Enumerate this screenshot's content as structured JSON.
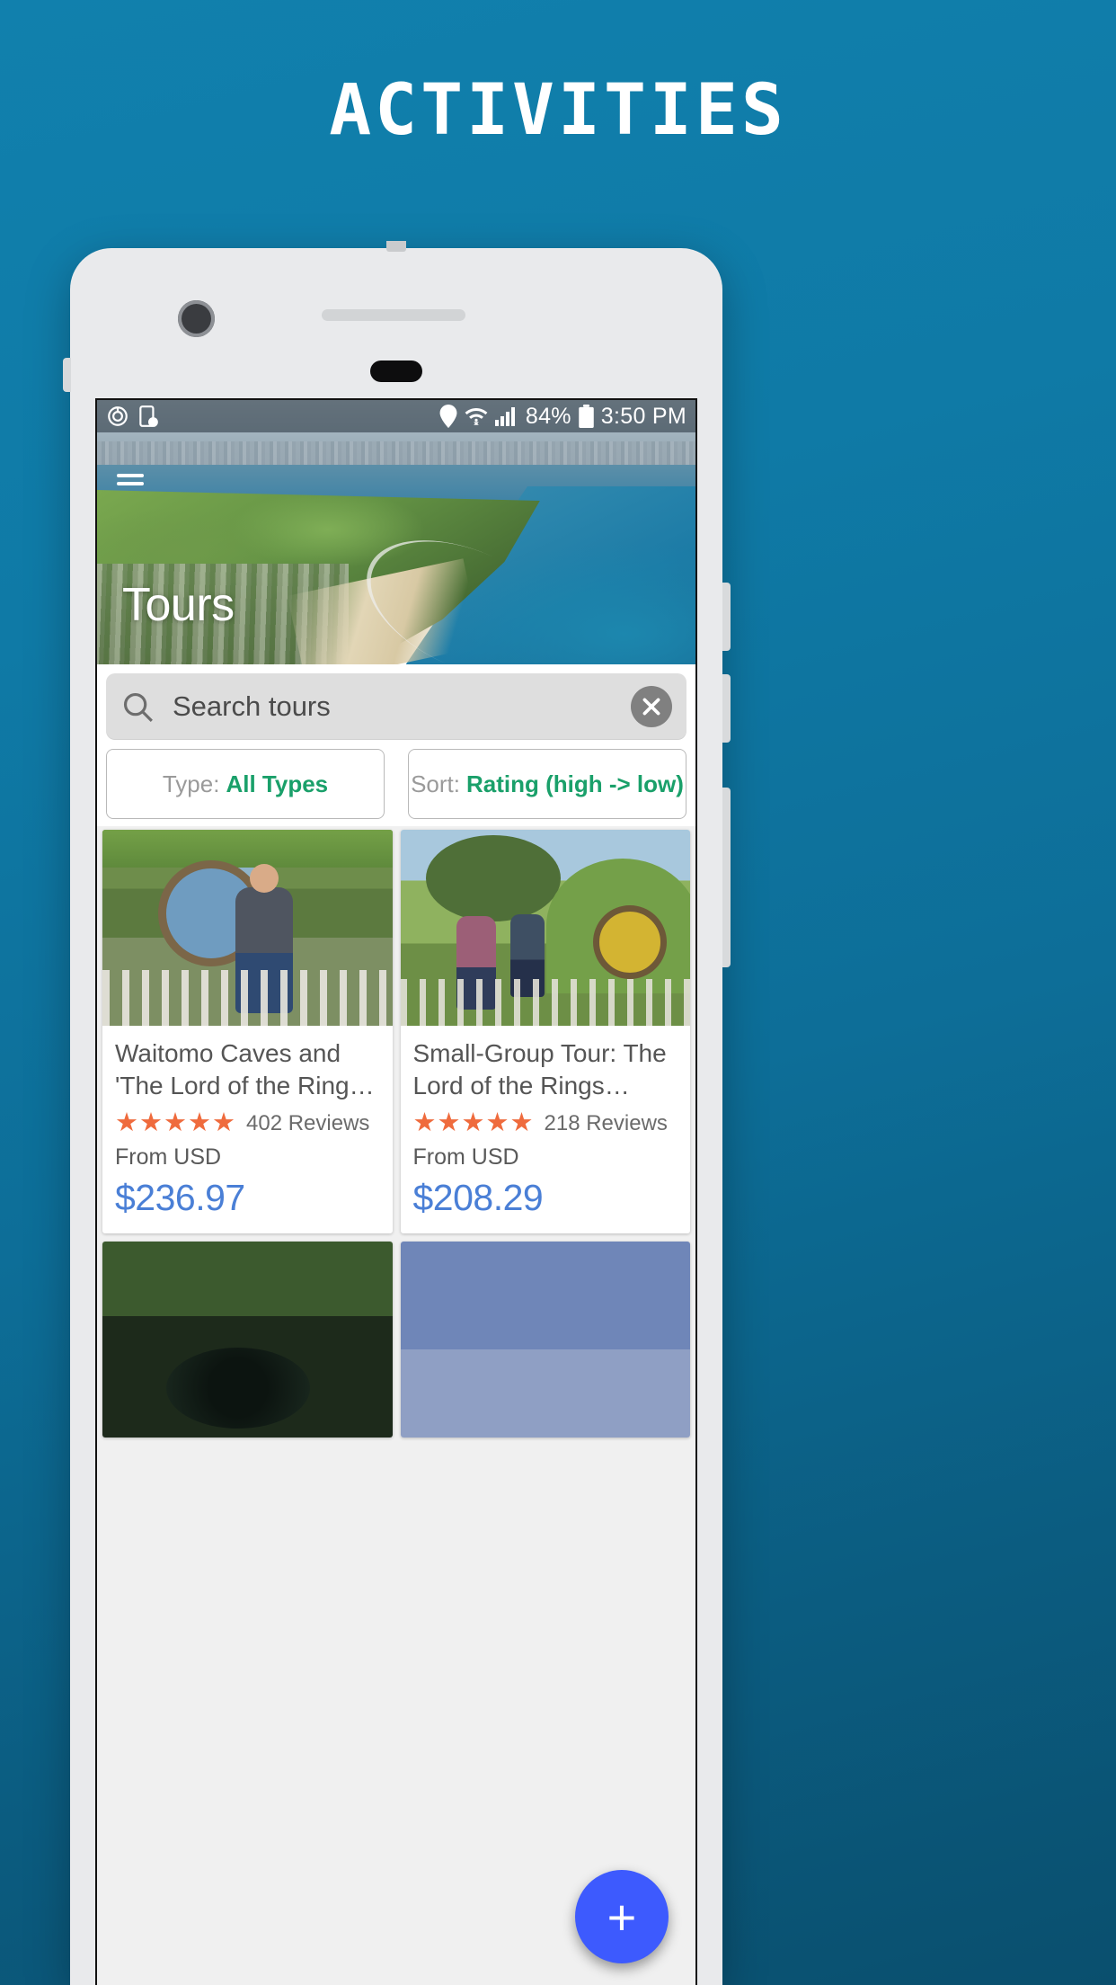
{
  "promo": {
    "headline": "ACTIVITIES"
  },
  "statusbar": {
    "left_icons": [
      "power-sync-icon",
      "screen-timer-icon"
    ],
    "right_icons": [
      "location-pin-icon",
      "wifi-icon",
      "cellular-signal-icon",
      "battery-icon"
    ],
    "battery_percent": "84%",
    "time": "3:50 PM"
  },
  "hero": {
    "title": "Tours",
    "menu_icon": "hamburger-menu-icon"
  },
  "search": {
    "placeholder": "Search tours",
    "value": "",
    "search_icon": "search-icon",
    "clear_icon": "close-icon"
  },
  "filters": [
    {
      "name": "type",
      "label": "Type:",
      "value": "All Types"
    },
    {
      "name": "sort",
      "label": "Sort:",
      "value": "Rating (high -> low)"
    }
  ],
  "cards": [
    {
      "title": "Waitomo Caves and 'The Lord of the Ring…",
      "stars": "★★★★★",
      "rating": 5,
      "reviews": "402 Reviews",
      "from_label": "From USD",
      "price": "$236.97",
      "image": "hobbit-hole-blue-door-photo"
    },
    {
      "title": "Small-Group Tour: The Lord of the Rings…",
      "stars": "★★★★★",
      "rating": 5,
      "reviews": "218 Reviews",
      "from_label": "From USD",
      "price": "$208.29",
      "image": "hobbiton-garden-group-photo"
    },
    {
      "title": "",
      "stars": "",
      "rating": 0,
      "reviews": "",
      "from_label": "",
      "price": "",
      "image": "glowworm-cave-photo"
    },
    {
      "title": "",
      "stars": "",
      "rating": 0,
      "reviews": "",
      "from_label": "",
      "price": "",
      "image": "blue-landscape-photo"
    }
  ],
  "fab": {
    "label": "+",
    "icon": "plus-icon"
  },
  "colors": {
    "background_blue": "#0f7aa6",
    "accent_green": "#1aa06a",
    "price_blue": "#4a7fd6",
    "star_orange": "#ef6b3d",
    "fab_blue": "#3d5afe"
  }
}
